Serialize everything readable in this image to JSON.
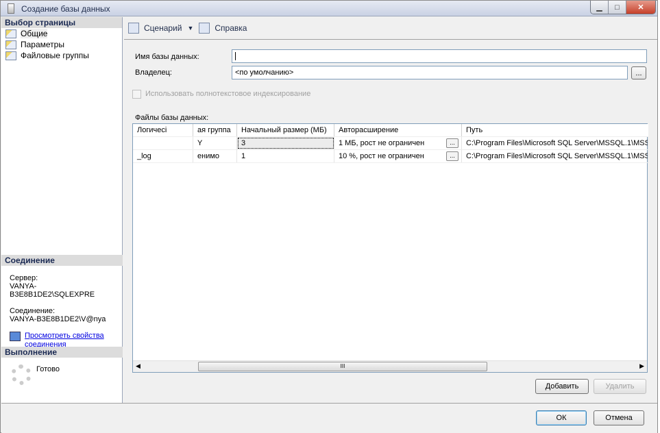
{
  "window": {
    "title": "Создание базы данных"
  },
  "left": {
    "header": "Выбор страницы",
    "pages": [
      "Общие",
      "Параметры",
      "Файловые группы"
    ],
    "connection": {
      "header": "Соединение",
      "server_label": "Сервер:",
      "server": "VANYA-B3E8B1DE2\\SQLEXPRE",
      "conn_label": "Соединение:",
      "conn": "VANYA-B3E8B1DE2\\V@nya",
      "link": "Просмотреть свойства соединения"
    },
    "execution": {
      "header": "Выполнение",
      "status": "Готово"
    }
  },
  "toolbar": {
    "script": "Сценарий",
    "help": "Справка"
  },
  "form": {
    "db_name_label": "Имя базы данных:",
    "db_name": "",
    "owner_label": "Владелец:",
    "owner": "<по умолчанию>",
    "fulltext_label": "Использовать полнотекстовое индексирование",
    "files_label": "Файлы базы данных:"
  },
  "grid": {
    "headers": [
      "Логичесі",
      "ая группа",
      "Начальный размер (МБ)",
      "Авторасширение",
      "Путь"
    ],
    "rows": [
      [
        "",
        "Y",
        "3",
        "1 МБ, рост не ограничен",
        "C:\\Program Files\\Microsoft SQL Server\\MSSQL.1\\MSS"
      ],
      [
        "_log",
        "енимо",
        "1",
        "10 %, рост не ограничен",
        "C:\\Program Files\\Microsoft SQL Server\\MSSQL.1\\MSS"
      ]
    ]
  },
  "buttons": {
    "add": "Добавить",
    "remove": "Удалить",
    "ok": "ОК",
    "cancel": "Отмена",
    "ellipsis": "...",
    "scroll_grip": "III"
  }
}
